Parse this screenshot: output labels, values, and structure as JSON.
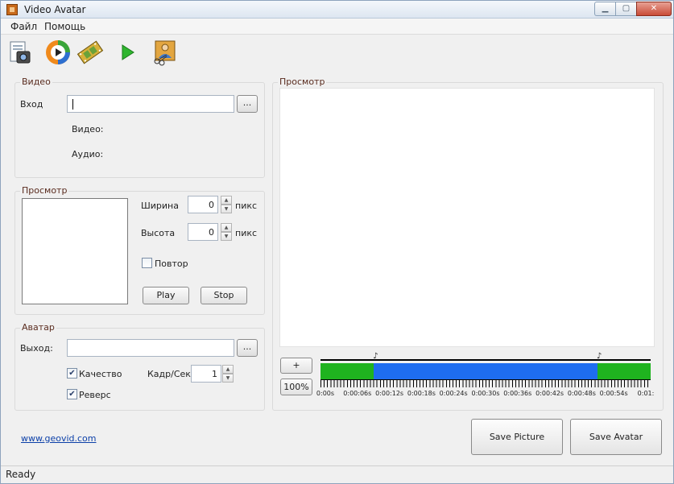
{
  "window": {
    "title": "Video Avatar"
  },
  "menu": [
    "Файл",
    "Помощь"
  ],
  "toolbar": {
    "icons": [
      "open-video-icon",
      "media-player-icon",
      "film-icon",
      "play-icon",
      "avatar-cut-icon"
    ]
  },
  "video_group": {
    "title": "Видео",
    "input_label": "Вход",
    "input_value": "",
    "browse_label": "...",
    "video_label": "Видео:",
    "audio_label": "Аудио:"
  },
  "preview_group": {
    "title": "Просмотр",
    "width_label": "Ширина",
    "width_value": "0",
    "height_label": "Высота",
    "height_value": "0",
    "unit": "пикс",
    "repeat_label": "Повтор",
    "repeat_checked": false,
    "play_label": "Play",
    "stop_label": "Stop"
  },
  "avatar_group": {
    "title": "Аватар",
    "output_label": "Выход:",
    "output_value": "",
    "browse_label": "...",
    "quality_label": "Качество",
    "quality_checked": true,
    "fps_label": "Кадр/Сек",
    "fps_value": "1",
    "reverse_label": "Реверс",
    "reverse_checked": true
  },
  "main_preview": {
    "title": "Просмотр",
    "zoom_in_label": "+",
    "zoom_label": "100%"
  },
  "timeline": {
    "selection_start_s": 10,
    "selection_end_s": 52,
    "total_s": 62,
    "tick_labels": [
      "0:00s",
      "0:00:06s",
      "0:00:12s",
      "0:00:18s",
      "0:00:24s",
      "0:00:30s",
      "0:00:36s",
      "0:00:42s",
      "0:00:48s",
      "0:00:54s",
      "0:01:"
    ],
    "colors": {
      "outside": "#1fb31f",
      "selection": "#1e6df0"
    }
  },
  "footer": {
    "link_text": "www.geovid.com",
    "save_picture_label": "Save Picture",
    "save_avatar_label": "Save Avatar"
  },
  "status": {
    "text": "Ready"
  }
}
